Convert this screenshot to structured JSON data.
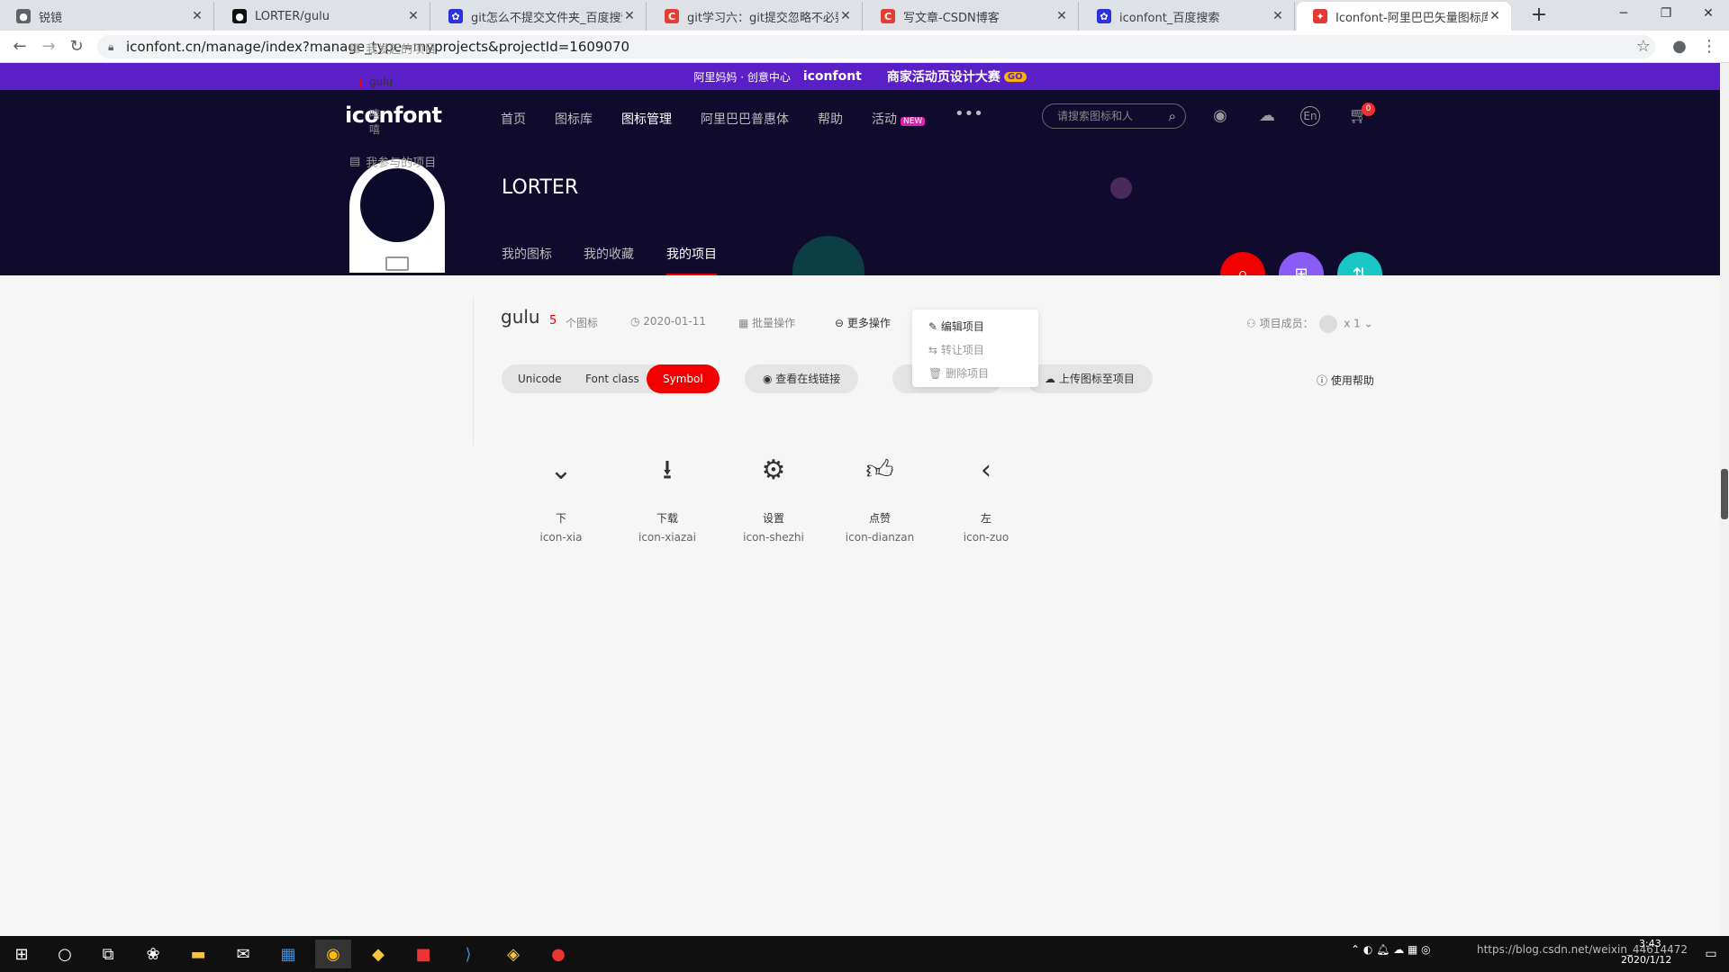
{
  "browser": {
    "tabs": [
      {
        "title": "锐镜",
        "favicon": "chrome-icon",
        "color": "#5f6368"
      },
      {
        "title": "LORTER/gulu",
        "favicon": "github-icon",
        "color": "#111111"
      },
      {
        "title": "git怎么不提交文件夹_百度搜索",
        "favicon": "baidu-paw-icon",
        "color": "#2932e1"
      },
      {
        "title": "git学习六：git提交忽略不必要的",
        "favicon": "csdn-c-icon",
        "color": "#e33e33"
      },
      {
        "title": "写文章-CSDN博客",
        "favicon": "csdn-c-icon",
        "color": "#e33e33"
      },
      {
        "title": "iconfont_百度搜索",
        "favicon": "baidu-paw-icon",
        "color": "#2932e1"
      },
      {
        "title": "Iconfont-阿里巴巴矢量图标库",
        "favicon": "iconfont-icon",
        "color": "#e53935"
      }
    ],
    "url": "iconfont.cn/manage/index?manage_type=myprojects&projectId=1609070"
  },
  "banner": {
    "brand": "阿里妈妈 · 创意中心",
    "logo": "iconfont",
    "text": "商家活动页设计大赛",
    "go": "GO"
  },
  "header": {
    "logo": "iconfont",
    "menu": [
      "首页",
      "图标库",
      "图标管理",
      "阿里巴巴普惠体",
      "帮助",
      "活动"
    ],
    "new_badge": "NEW",
    "search_placeholder": "请搜索图标和人",
    "cart_count": "0",
    "lang": "En"
  },
  "profile": {
    "username": "LORTER",
    "tabs": [
      "我的图标",
      "我的收藏",
      "我的项目"
    ]
  },
  "sidebar": {
    "started": "我发起的项目",
    "started_items": [
      "gulu",
      "嘻嘻"
    ],
    "joined": "我参与的项目"
  },
  "project": {
    "name": "gulu",
    "count": "5",
    "count_label": "个图标",
    "date": "2020-01-11",
    "batch": "批量操作",
    "more": "更多操作",
    "members_label": "项目成员：",
    "members_count": "x 1",
    "formats": [
      "Unicode",
      "Font class",
      "Symbol"
    ],
    "view_link": "查看在线链接",
    "upload": "上传图标至项目",
    "help": "使用帮助"
  },
  "dropdown": [
    "编辑项目",
    "转让项目",
    "删除项目"
  ],
  "icons": [
    {
      "name": "下",
      "code": "icon-xia",
      "glyph": "chevron-down-icon"
    },
    {
      "name": "下载",
      "code": "icon-xiazai",
      "glyph": "download-icon"
    },
    {
      "name": "设置",
      "code": "icon-shezhi",
      "glyph": "gear-icon"
    },
    {
      "name": "点赞",
      "code": "icon-dianzan",
      "glyph": "thumbs-up-icon"
    },
    {
      "name": "左",
      "code": "icon-zuo",
      "glyph": "chevron-left-icon"
    }
  ],
  "taskbar": {
    "time": "3:43",
    "date": "2020/1/12",
    "watermark": "https://blog.csdn.net/weixin_44614472"
  }
}
